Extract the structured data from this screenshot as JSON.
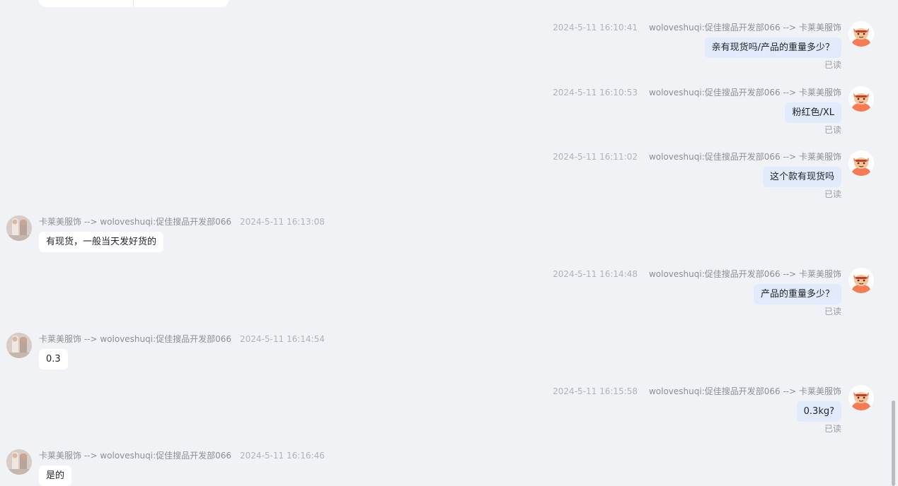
{
  "colors": {
    "background": "#f1f2f6",
    "bubble_sent": "#e2ebfb",
    "bubble_received": "#ffffff",
    "meta_text": "#9a9ca3",
    "avatar_robot": "#f47b52"
  },
  "messages": [
    {
      "side": "right",
      "time": "2024-5-11 16:10:41",
      "sender": "woloveshuqi:促佳搜品开发部066 --> 卡莱美服饰",
      "text": "亲有现货吗/产品的重量多少？",
      "read": "已读",
      "avatar_icon": "robot-mascot-icon"
    },
    {
      "side": "right",
      "time": "2024-5-11 16:10:53",
      "sender": "woloveshuqi:促佳搜品开发部066 --> 卡莱美服饰",
      "text": "粉红色/XL",
      "read": "已读",
      "avatar_icon": "robot-mascot-icon"
    },
    {
      "side": "right",
      "time": "2024-5-11 16:11:02",
      "sender": "woloveshuqi:促佳搜品开发部066 --> 卡莱美服饰",
      "text": "这个款有现货吗",
      "read": "已读",
      "avatar_icon": "robot-mascot-icon"
    },
    {
      "side": "left",
      "time": "2024-5-11 16:13:08",
      "sender": "卡莱美服饰 --> woloveshuqi:促佳搜品开发部066",
      "text": "有现货，一般当天发好货的",
      "avatar_icon": "shop-photo-avatar"
    },
    {
      "side": "right",
      "time": "2024-5-11 16:14:48",
      "sender": "woloveshuqi:促佳搜品开发部066 --> 卡莱美服饰",
      "text": "产品的重量多少？",
      "read": "已读",
      "avatar_icon": "robot-mascot-icon"
    },
    {
      "side": "left",
      "time": "2024-5-11 16:14:54",
      "sender": "卡莱美服饰 --> woloveshuqi:促佳搜品开发部066",
      "text": "0.3",
      "avatar_icon": "shop-photo-avatar"
    },
    {
      "side": "right",
      "time": "2024-5-11 16:15:58",
      "sender": "woloveshuqi:促佳搜品开发部066 --> 卡莱美服饰",
      "text": "0.3kg?",
      "read": "已读",
      "avatar_icon": "robot-mascot-icon"
    },
    {
      "side": "left",
      "time": "2024-5-11 16:16:46",
      "sender": "卡莱美服饰 --> woloveshuqi:促佳搜品开发部066",
      "text": "是的",
      "avatar_icon": "shop-photo-avatar"
    }
  ]
}
